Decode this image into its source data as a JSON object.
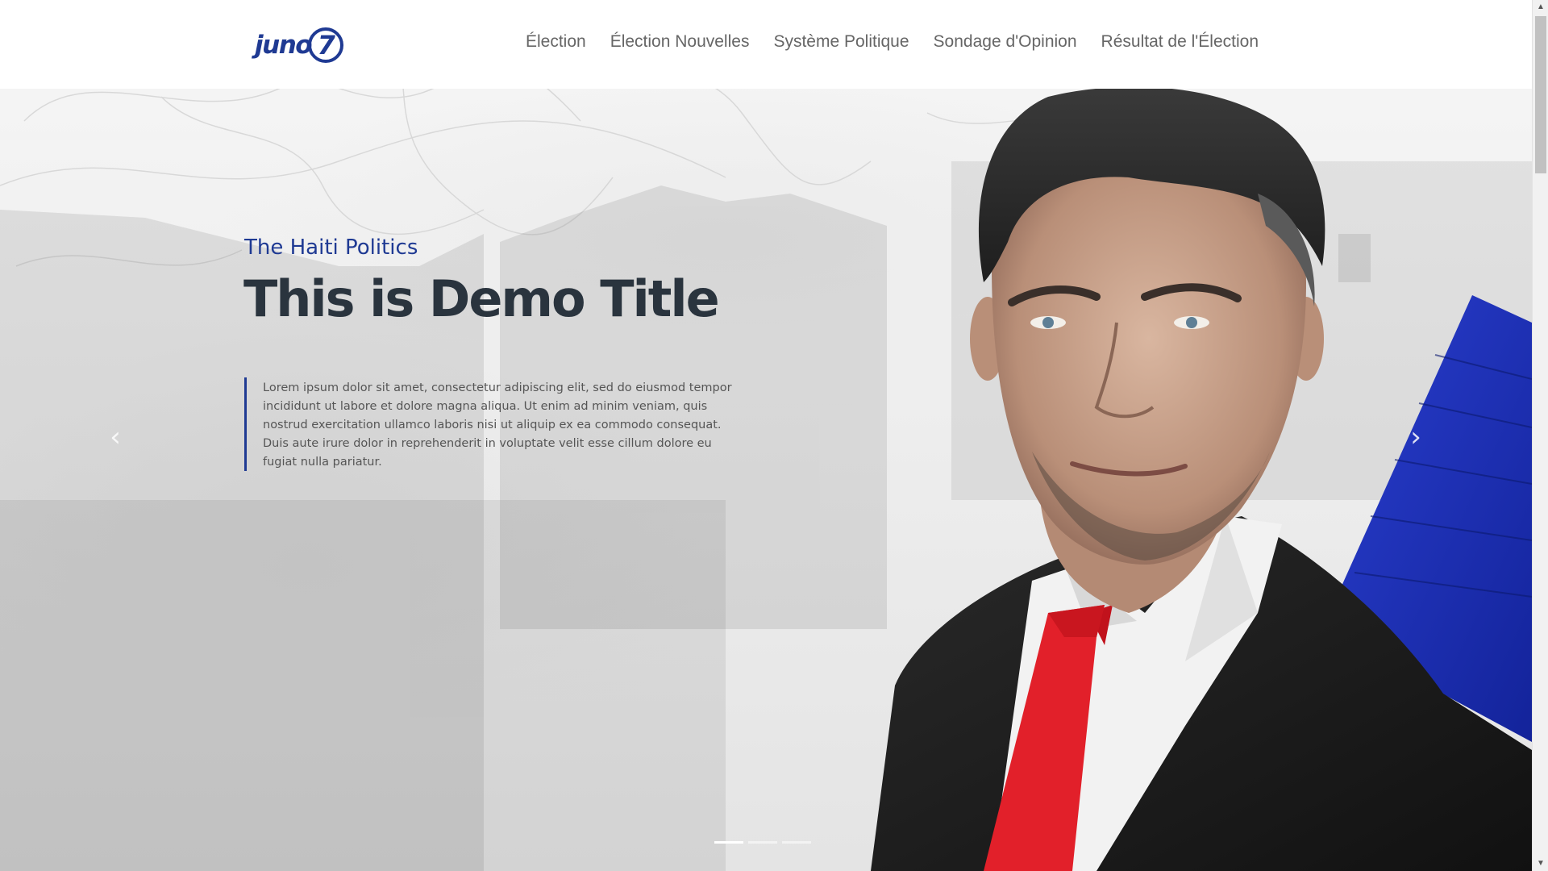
{
  "header": {
    "logo_text": "juno",
    "logo_badge": "7",
    "nav": [
      {
        "label": "Élection"
      },
      {
        "label": "Élection Nouvelles"
      },
      {
        "label": "Système Politique"
      },
      {
        "label": "Sondage d'Opinion"
      },
      {
        "label": "Résultat de l'Élection"
      }
    ]
  },
  "hero": {
    "subtitle": "The Haiti Politics",
    "title": "This is Demo Title",
    "body": "Lorem ipsum dolor sit amet, consectetur adipiscing elit, sed do eiusmod tempor incididunt ut labore et dolore magna aliqua. Ut enim ad minim veniam, quis nostrud exercitation ullamco laboris nisi ut aliquip ex ea commodo consequat. Duis aute irure dolor in reprehenderit in voluptate velit esse cillum dolore eu fugiat nulla pariatur.",
    "prev_icon": "chevron-left-icon",
    "next_icon": "chevron-right-icon",
    "prev_glyph": "‹",
    "next_glyph": "›",
    "slide_count": 3,
    "active_slide": 1
  },
  "colors": {
    "brand": "#1f3a93",
    "title": "#2a343e",
    "nav_text": "#666666",
    "tie": "#e2202a",
    "accent_blue": "#1b2fb8"
  },
  "scrollbar": {
    "up_glyph": "▲",
    "down_glyph": "▼"
  }
}
